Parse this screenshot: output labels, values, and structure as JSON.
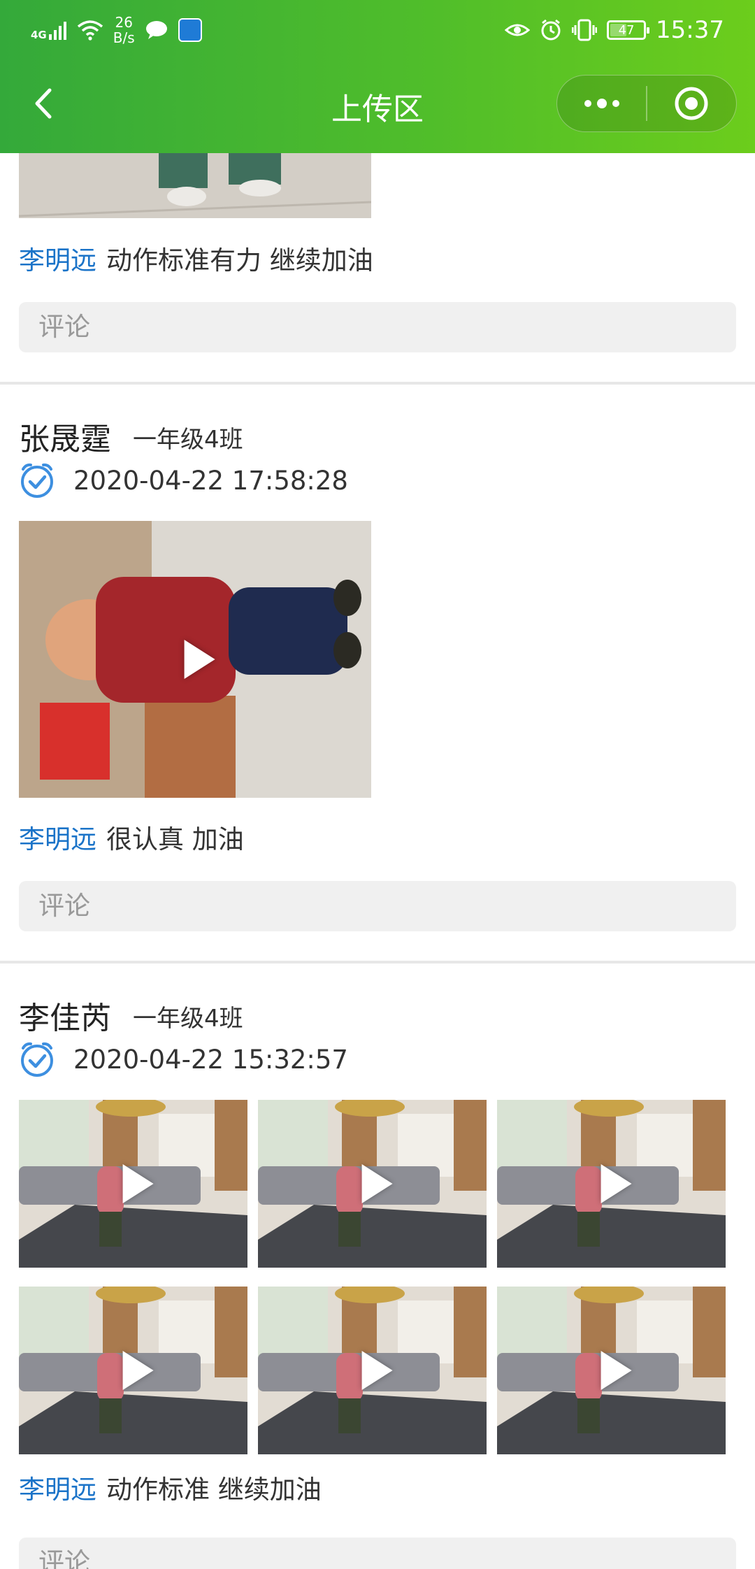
{
  "status_bar": {
    "network": "4G",
    "speed_value": "26",
    "speed_unit": "B/s",
    "battery": "47",
    "time": "15:37"
  },
  "nav": {
    "title": "上传区"
  },
  "posts": [
    {
      "reply": {
        "author": "李明远",
        "text": "动作标准有力 继续加油"
      },
      "comment_placeholder": "评论"
    },
    {
      "student": "张晟霆",
      "class": "一年级4班",
      "timestamp": "2020-04-22 17:58:28",
      "reply": {
        "author": "李明远",
        "text": "很认真 加油"
      },
      "comment_placeholder": "评论"
    },
    {
      "student": "李佳芮",
      "class": "一年级4班",
      "timestamp": "2020-04-22 15:32:57",
      "reply": {
        "author": "李明远",
        "text": "动作标准 继续加油"
      },
      "comment_placeholder": "评论"
    }
  ],
  "colors": {
    "header_start": "#34a93a",
    "header_end": "#6ccd1c",
    "author_link": "#1a73c8",
    "clock_icon": "#3d8fe0"
  }
}
